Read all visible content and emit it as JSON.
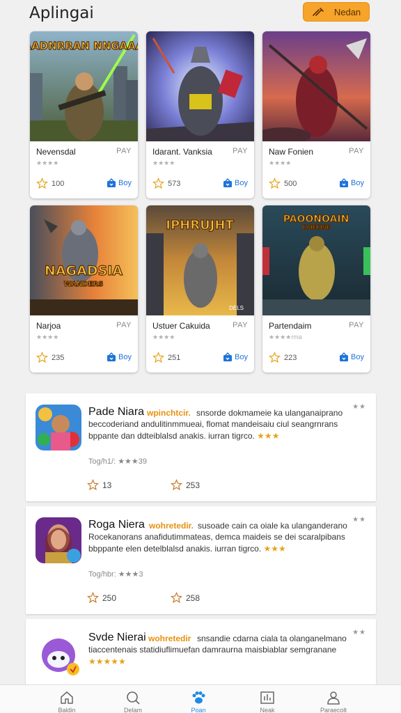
{
  "header": {
    "title": "Aplingai",
    "button_label": "Nedan",
    "button_icon": "wand-icon"
  },
  "cards": [
    {
      "name": "Nevensdal",
      "pay": "PAY",
      "stars": "★★★★",
      "rating": "100",
      "buy": "Boy",
      "art_title": "BAADNRRAN NNGAAAA",
      "art_caption": ""
    },
    {
      "name": "Idarant. Vanksia",
      "pay": "PAY",
      "stars": "★★★★",
      "rating": "573",
      "buy": "Boy",
      "art_title": "",
      "art_caption": ""
    },
    {
      "name": "Naw Fonien",
      "pay": "PAY",
      "stars": "★★★★",
      "rating": "500",
      "buy": "Boy",
      "art_title": "",
      "art_caption": ""
    },
    {
      "name": "Narjoa",
      "pay": "PAY",
      "stars": "★★★★",
      "rating": "235",
      "buy": "Boy",
      "art_title": "NAGADSIA",
      "art_caption": "WANDERS"
    },
    {
      "name": "Ustuer Cakuida",
      "pay": "PAY",
      "stars": "★★★★",
      "rating": "251",
      "buy": "Boy",
      "art_title": "IPHRUJHT",
      "art_caption": "DELS"
    },
    {
      "name": "Partendaim",
      "pay": "PAY",
      "stars": "★★★★rma",
      "rating": "223",
      "buy": "Boy",
      "art_title": "PAOONOAIN",
      "art_caption": "CAIECISE"
    }
  ],
  "list": [
    {
      "title": "Pade Niara",
      "tag": "wpinchtcir.",
      "line1": "snsorde dokmameie ka ulanganaiprano",
      "line2": "beccoderiand andulitinmmueai, flomat mandeisaiu ciul seangrnrans",
      "line3": "bppante dan ddteiblalsd anakis. iurran tigrco.",
      "line3_stars": "★★★",
      "meta": "Tog/h1/: ★★★39",
      "stat1": "13",
      "stat2": "253",
      "more": "★★"
    },
    {
      "title": "Roga Niera",
      "tag": "wohretedir.",
      "line1": "susoade cain ca oiale ka ulanganderano",
      "line2": "Rocekanorans anafidutimmateas, demca maideis se dei scaralpibans",
      "line3": "bbppante elen detelblalsd anakis. iurran tigrco.",
      "line3_stars": "★★★",
      "meta": "Tog/hbr: ★★★3",
      "stat1": "250",
      "stat2": "258",
      "more": "★★"
    },
    {
      "title": "Svde Nierai",
      "tag": "wohretedir",
      "line1": "snsandie cdarna ciala ta olanganelmano",
      "line2": "tiaccentenais statidiuflimuefan damraurna maisbiablar semgranane",
      "line3": "",
      "line3_stars": "★★★★★",
      "meta": "",
      "stat1": "",
      "stat2": "",
      "more": "★★"
    }
  ],
  "tabs": [
    {
      "label": "Baldin",
      "icon": "home-icon"
    },
    {
      "label": "Delam",
      "icon": "search-icon"
    },
    {
      "label": "Poan",
      "icon": "paw-icon"
    },
    {
      "label": "Neak",
      "icon": "chart-icon"
    },
    {
      "label": "Paraecolt",
      "icon": "profile-icon"
    }
  ],
  "colors": {
    "accent": "#f6a42a",
    "link": "#1d74d8",
    "active_tab": "#1d8ae8",
    "star": "#e6a21a"
  }
}
